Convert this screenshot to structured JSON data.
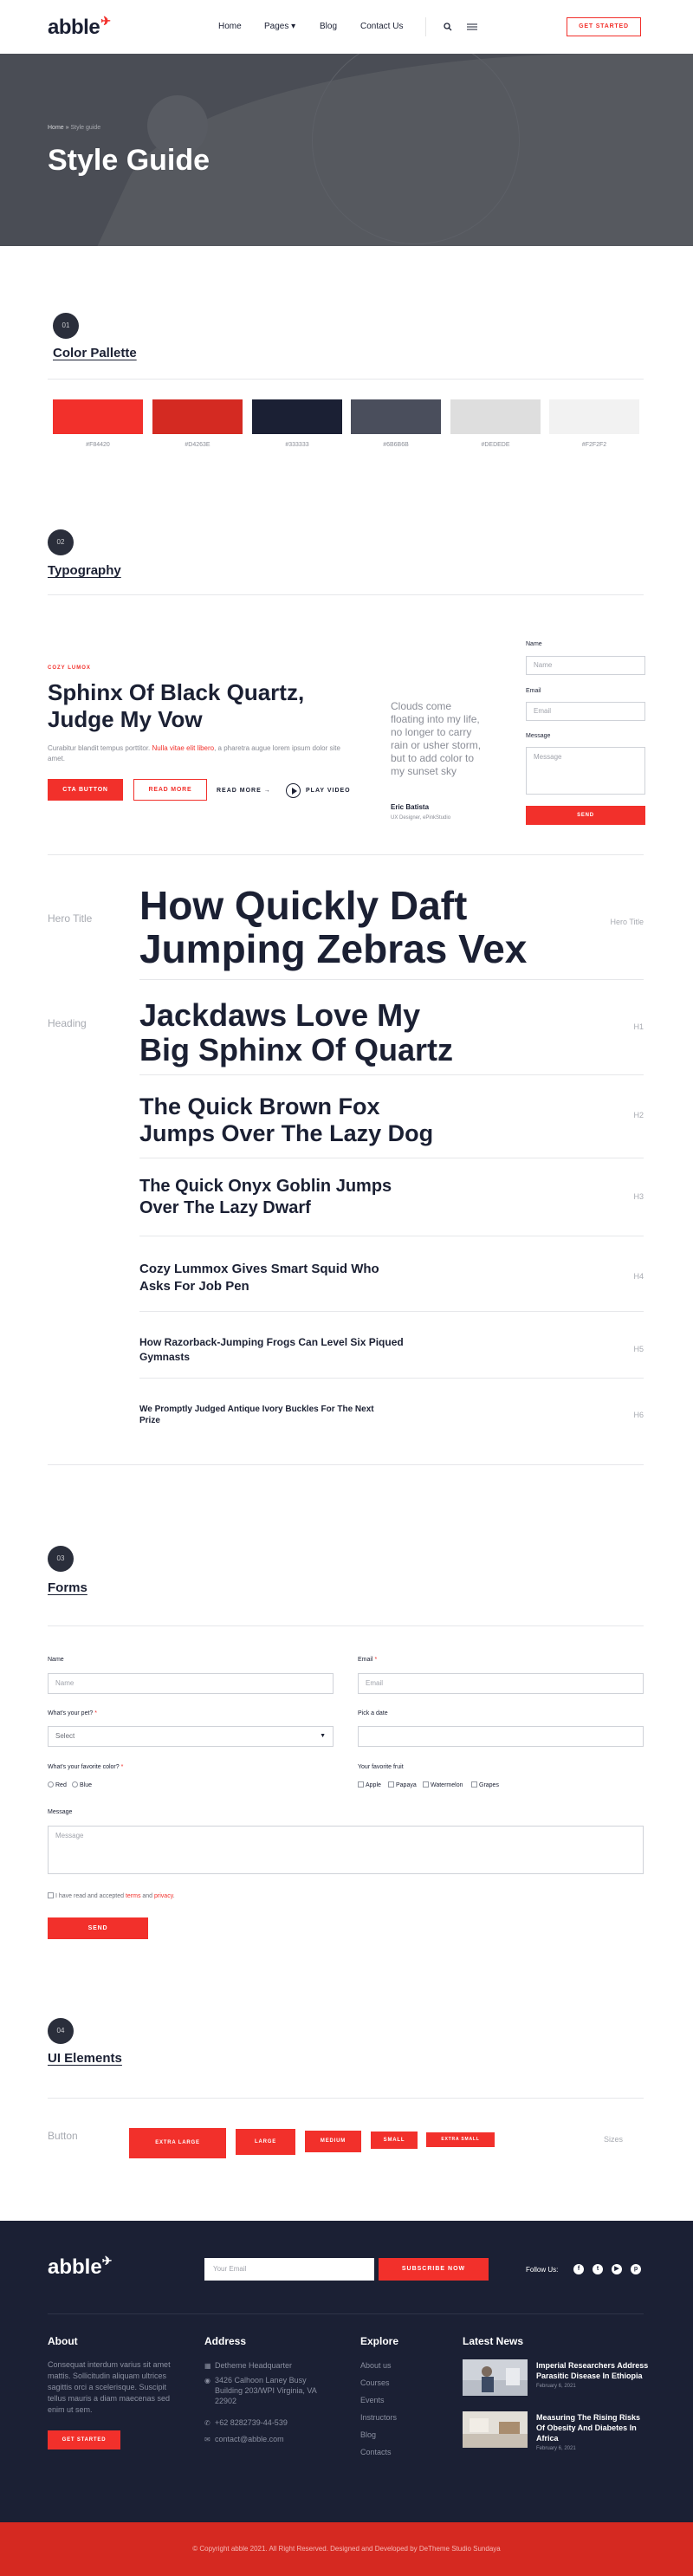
{
  "header": {
    "logo": "abble",
    "nav": [
      "Home",
      "Pages",
      "Blog",
      "Contact Us"
    ],
    "pages_caret": "▾",
    "cta": "GET STARTED"
  },
  "hero": {
    "breadcrumb_home": "Home",
    "breadcrumb_sep": "»",
    "breadcrumb_current": "Style guide",
    "title": "Style Guide"
  },
  "colors_section": {
    "number": "01",
    "title": "Color Pallette",
    "swatches": [
      {
        "hex": "#F84420",
        "color": "#f2302b",
        "label": "#F84420"
      },
      {
        "hex": "#D4263E",
        "color": "#d42a22",
        "label": "#D4263E"
      },
      {
        "hex": "#333333",
        "color": "#1b2034",
        "label": "#333333"
      },
      {
        "hex": "#6B6B6B",
        "color": "#4a4e5c",
        "label": "#6B6B6B"
      },
      {
        "hex": "#DEDEDE",
        "color": "#dedede",
        "label": "#DEDEDE"
      },
      {
        "hex": "#F2F2F2",
        "color": "#f2f2f2",
        "label": "#F2F2F2"
      }
    ]
  },
  "typography_section": {
    "number": "02",
    "title": "Typography",
    "eyebrow": "COZY LUMOX",
    "heading": "Sphinx Of Black Quartz, Judge My Vow",
    "para_start": "Curabitur blandit tempus porttitor. ",
    "para_link": "Nulla vitae elit libero",
    "para_end": ", a pharetra augue lorem ipsum dolor site amet.",
    "cta_button": "CTA BUTTON",
    "read_more_button": "READ MORE",
    "read_more_link": "READ MORE  →",
    "play_label": "PLAY VIDEO",
    "quote": "Clouds come floating into my life, no longer to carry rain or usher storm, but to add color to my sunset sky",
    "quote_author": "Eric Batista",
    "quote_role": "UX Designer, ePinkStudio",
    "contact_form": {
      "name_label": "Name",
      "name_placeholder": "Name",
      "email_label": "Email",
      "email_placeholder": "Email",
      "message_label": "Message",
      "message_placeholder": "Message",
      "send": "SEND"
    },
    "scale": [
      {
        "label": "Hero Title",
        "tag": "Hero Title",
        "text_line1": "How Quickly Daft",
        "text_line2": "Jumping Zebras Vex"
      },
      {
        "label": "Heading",
        "tag": "H1",
        "text_line1": "Jackdaws Love My",
        "text_line2": "Big Sphinx Of Quartz"
      },
      {
        "label": "",
        "tag": "H2",
        "text_line1": "The Quick Brown Fox",
        "text_line2": "Jumps Over The Lazy Dog"
      },
      {
        "label": "",
        "tag": "H3",
        "text_line1": "The Quick Onyx Goblin Jumps",
        "text_line2": "Over The Lazy Dwarf"
      },
      {
        "label": "",
        "tag": "H4",
        "text_line1": "Cozy Lummox Gives Smart Squid Who",
        "text_line2": "Asks For Job Pen"
      },
      {
        "label": "",
        "tag": "H5",
        "text_line1": "How Razorback-Jumping Frogs Can Level Six Piqued",
        "text_line2": "Gymnasts"
      },
      {
        "label": "",
        "tag": "H6",
        "text_line1": "We Promptly Judged Antique Ivory Buckles For The Next",
        "text_line2": "Prize"
      }
    ]
  },
  "forms_section": {
    "number": "03",
    "title": "Forms",
    "name_label": "Name",
    "name_placeholder": "Name",
    "email_label": "Email",
    "email_placeholder": "Email",
    "required_mark": "*",
    "pet_label": "What's your pet?",
    "pet_value": "Select",
    "date_label": "Pick a date",
    "color_label": "What's your favorite color?",
    "colors": [
      "Red",
      "Blue"
    ],
    "fruit_label": "Your favorite fruit",
    "fruits": [
      "Apple",
      "Papaya",
      "Watermelon",
      "Grapes"
    ],
    "message_label": "Message",
    "message_placeholder": "Message",
    "terms_start": "I have read and accepted ",
    "terms_link": "terms",
    "terms_and": " and ",
    "privacy_link": "privacy",
    "terms_end": ".",
    "send": "SEND"
  },
  "ui_section": {
    "number": "04",
    "title": "UI Elements",
    "row_label": "Button",
    "row_tag": "Sizes",
    "buttons": [
      "EXTRA LARGE",
      "LARGE",
      "MEDIUM",
      "SMALL",
      "EXTRA SMALL"
    ]
  },
  "footer": {
    "logo": "abble",
    "email_placeholder": "Your Email",
    "subscribe": "SUBSCRIBE NOW",
    "follow": "Follow Us:",
    "social_icons": [
      "facebook-icon",
      "twitter-icon",
      "youtube-icon",
      "pinterest-icon"
    ],
    "social_glyphs": [
      "f",
      "t",
      "▶",
      "p"
    ],
    "about_title": "About",
    "about_text": "Consequat interdum varius sit amet mattis. Sollicitudin aliquam ultrices sagittis orci a scelerisque. Suscipit tellus mauris a diam maecenas sed enim ut sem.",
    "about_button": "GET STARTED",
    "address_title": "Address",
    "address_name": "Detheme Headquarter",
    "address_lines": "3426 Calhoon Laney Busy Building 203/WPI Virginia, VA 22902",
    "phone": "+62 8282739-44-539",
    "email": "contact@abble.com",
    "explore_title": "Explore",
    "explore_links": [
      "About us",
      "Courses",
      "Events",
      "Instructors",
      "Blog",
      "Contacts"
    ],
    "news_title": "Latest News",
    "news": [
      {
        "title": "Imperial Researchers Address Parasitic Disease In Ethiopia",
        "date": "February 6, 2021"
      },
      {
        "title": "Measuring The Rising Risks Of Obesity And Diabetes In Africa",
        "date": "February 6, 2021"
      }
    ],
    "copyright": "© Copyright abble 2021. All Right Reserved. Designed and Developed by DeTheme Studio Sundaya"
  }
}
